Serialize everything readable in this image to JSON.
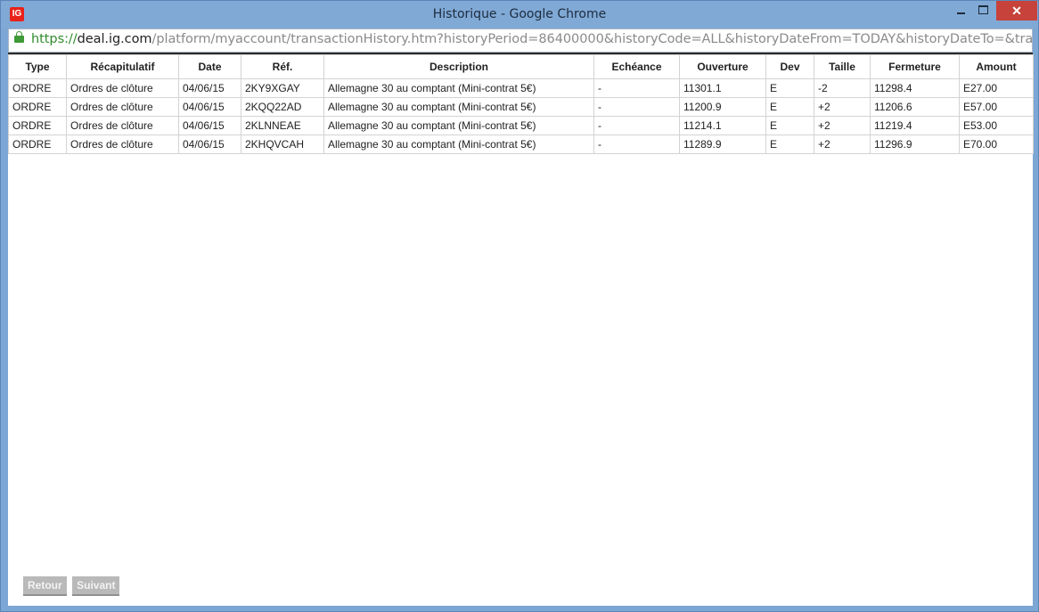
{
  "window": {
    "title": "Historique - Google Chrome",
    "app_icon_text": "IG",
    "close_glyph": "✕"
  },
  "address": {
    "scheme": "https://",
    "host": "deal.ig.com",
    "path": "/platform/myaccount/transactionHistory.htm?historyPeriod=86400000&historyCode=ALL&historyDateFrom=TODAY&historyDateTo=&tran"
  },
  "table": {
    "headers": [
      "Type",
      "Récapitulatif",
      "Date",
      "Réf.",
      "Description",
      "Echéance",
      "Ouverture",
      "Dev",
      "Taille",
      "Fermeture",
      "Amount"
    ],
    "rows": [
      [
        "ORDRE",
        "Ordres de clôture",
        "04/06/15",
        "2KY9XGAY",
        "Allemagne 30 au comptant (Mini-contrat 5€)",
        "-",
        "11301.1",
        "E",
        "-2",
        "11298.4",
        "E27.00"
      ],
      [
        "ORDRE",
        "Ordres de clôture",
        "04/06/15",
        "2KQQ22AD",
        "Allemagne 30 au comptant (Mini-contrat 5€)",
        "-",
        "11200.9",
        "E",
        "+2",
        "11206.6",
        "E57.00"
      ],
      [
        "ORDRE",
        "Ordres de clôture",
        "04/06/15",
        "2KLNNEAE",
        "Allemagne 30 au comptant (Mini-contrat 5€)",
        "-",
        "11214.1",
        "E",
        "+2",
        "11219.4",
        "E53.00"
      ],
      [
        "ORDRE",
        "Ordres de clôture",
        "04/06/15",
        "2KHQVCAH",
        "Allemagne 30 au comptant (Mini-contrat 5€)",
        "-",
        "11289.9",
        "E",
        "+2",
        "11296.9",
        "E70.00"
      ]
    ]
  },
  "pager": {
    "back_label": "Retour",
    "next_label": "Suivant"
  },
  "colors": {
    "titlebar": "#80a9d6",
    "close_button": "#c7423a",
    "lock_green": "#3f9a37",
    "pager_button": "#b9b9b9"
  },
  "icons": {
    "app": "ig-logo-icon",
    "lock": "lock-icon",
    "minimize": "minimize-icon",
    "maximize": "maximize-icon",
    "close": "close-icon"
  }
}
